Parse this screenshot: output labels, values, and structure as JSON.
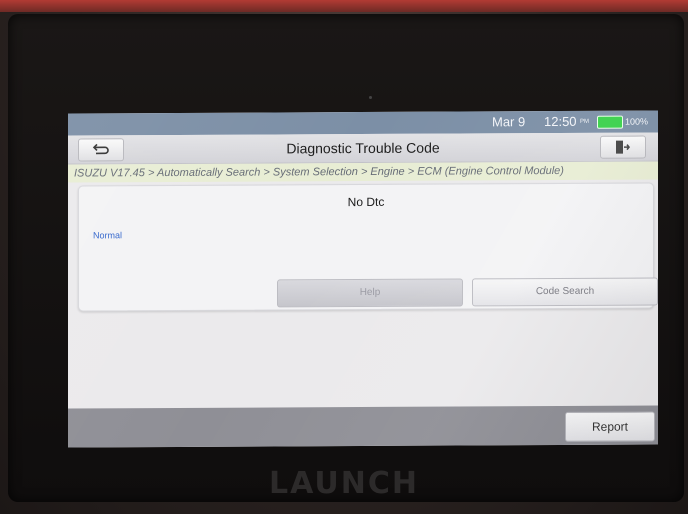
{
  "status": {
    "date": "Mar 9",
    "time": "12:50",
    "ampm": "PM",
    "battery": "100%",
    "battery_color": "#39d14a"
  },
  "header": {
    "title": "Diagnostic Trouble Code",
    "back_icon": "back-arrow-icon",
    "exit_icon": "exit-door-icon"
  },
  "breadcrumb": "ISUZU V17.45 > Automatically Search > System Selection > Engine > ECM (Engine Control Module)",
  "dtc": {
    "title": "No Dtc",
    "status": "Normal",
    "status_color": "#3366cc"
  },
  "buttons": {
    "help": "Help",
    "code_search": "Code Search",
    "report": "Report"
  },
  "device": {
    "brand": "LAUNCH"
  }
}
